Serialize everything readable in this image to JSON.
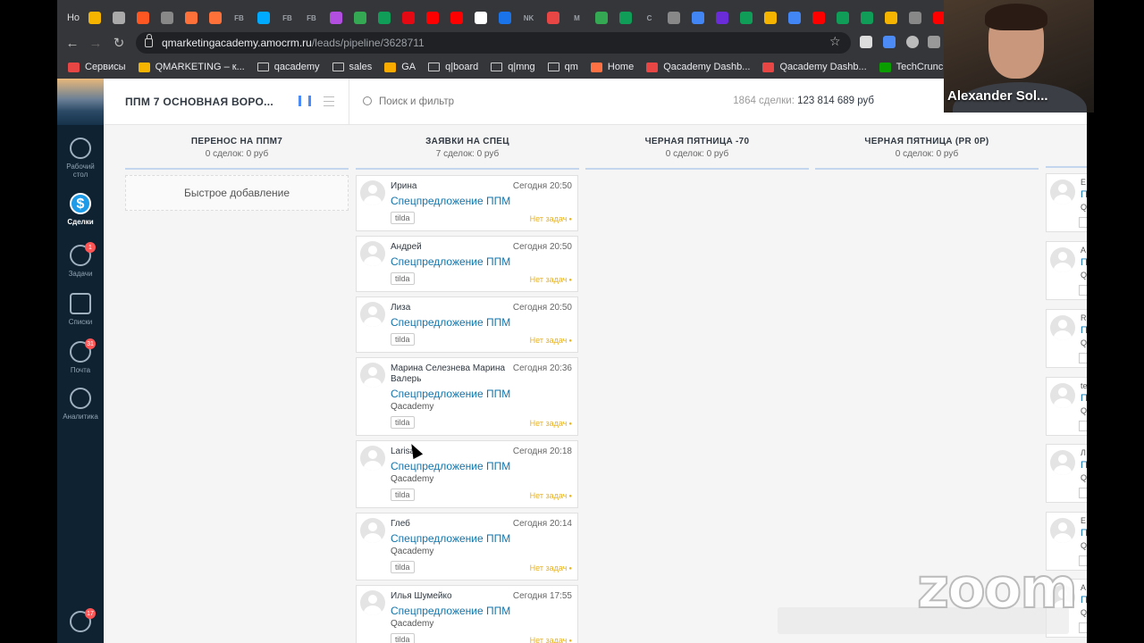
{
  "browser": {
    "first_tab": "Но",
    "tab_favicons": [
      {
        "icon": "google-drive-icon",
        "color": "#f4b400"
      },
      {
        "icon": "scissors-icon",
        "color": "#aaaaaa"
      },
      {
        "icon": "blogger-icon",
        "color": "#ff5722"
      },
      {
        "icon": "m-icon",
        "color": "#888888"
      },
      {
        "icon": "firefox-icon",
        "color": "#ff7139"
      },
      {
        "icon": "firefox-icon",
        "color": "#ff7139"
      },
      {
        "label": "FB",
        "icon": "fb-text-icon",
        "color": "#5f6368"
      },
      {
        "icon": "p-icon",
        "color": "#00aaff"
      },
      {
        "label": "FB",
        "icon": "fb-text-icon",
        "color": "#5f6368"
      },
      {
        "label": "FB",
        "icon": "fb-text-icon",
        "color": "#5f6368"
      },
      {
        "icon": "triangle-icon",
        "color": "#b34fe0"
      },
      {
        "icon": "green-circle-icon",
        "color": "#34a853"
      },
      {
        "icon": "sheets-icon",
        "color": "#0f9d58"
      },
      {
        "icon": "netflix-icon",
        "color": "#e50914"
      },
      {
        "icon": "youtube-icon",
        "color": "#ff0000"
      },
      {
        "icon": "youtube-icon",
        "color": "#ff0000"
      },
      {
        "icon": "reddit-icon",
        "color": "#ffffff"
      },
      {
        "icon": "doc-icon",
        "color": "#1a73e8"
      },
      {
        "label": "NK",
        "icon": "nk-icon",
        "color": "#444444"
      },
      {
        "icon": "k-icon",
        "color": "#e84545"
      },
      {
        "label": "M",
        "icon": "medium-icon",
        "color": "#000000"
      },
      {
        "icon": "gear-green-icon",
        "color": "#34a853"
      },
      {
        "icon": "leaf-icon",
        "color": "#0f9d58"
      },
      {
        "label": "C",
        "icon": "c-icon",
        "color": "#1a73e8"
      },
      {
        "icon": "grey-circle-icon",
        "color": "#888888"
      },
      {
        "icon": "docs-icon",
        "color": "#4285f4"
      },
      {
        "icon": "slack-icon",
        "color": "#6a2bd8"
      },
      {
        "icon": "sheets-plus-icon",
        "color": "#0f9d58"
      },
      {
        "icon": "smile-icon",
        "color": "#f4b400"
      },
      {
        "icon": "docs-icon",
        "color": "#4285f4"
      },
      {
        "icon": "youtube-icon",
        "color": "#ff0000"
      },
      {
        "icon": "sheets-plus-icon",
        "color": "#0f9d58"
      },
      {
        "icon": "sheets-plus-icon",
        "color": "#0f9d58"
      },
      {
        "icon": "slides-icon",
        "color": "#f4b400"
      },
      {
        "icon": "folder-icon",
        "color": "#888888"
      },
      {
        "icon": "youtube-icon",
        "color": "#ff0000"
      }
    ],
    "url_host": "qmarketingacademy.amocrm.ru",
    "url_path": "/leads/pipeline/3628711",
    "bookmarks": [
      {
        "label": "Сервисы",
        "icon": "apps-icon",
        "color": "#e84545"
      },
      {
        "label": "QMARKETING – к...",
        "icon": "qm-icon",
        "color": "#f4b400"
      },
      {
        "label": "qacademy",
        "icon": "folder-icon",
        "color": "#cccccc"
      },
      {
        "label": "sales",
        "icon": "folder-icon",
        "color": "#cccccc"
      },
      {
        "label": "GA",
        "icon": "analytics-icon",
        "color": "#f9ab00"
      },
      {
        "label": "q|board",
        "icon": "folder-icon",
        "color": "#cccccc"
      },
      {
        "label": "q|mng",
        "icon": "folder-icon",
        "color": "#cccccc"
      },
      {
        "label": "qm",
        "icon": "folder-icon",
        "color": "#cccccc"
      },
      {
        "label": "Home",
        "icon": "home-icon",
        "color": "#ff7043"
      },
      {
        "label": "Qacademy Dashb...",
        "icon": "dashboard-icon",
        "color": "#e84545"
      },
      {
        "label": "Qacademy Dashb...",
        "icon": "flag-icon",
        "color": "#e84545"
      },
      {
        "label": "TechCrunch",
        "icon": "techcrunch-icon",
        "color": "#0a9e01"
      }
    ]
  },
  "sidebar": {
    "items": [
      {
        "label": "Рабочий стол",
        "icon": "dashboard-gauge-icon"
      },
      {
        "label": "Сделки",
        "icon": "deals-dollar-icon",
        "active": true
      },
      {
        "label": "Задачи",
        "icon": "tasks-check-icon",
        "badge": "1"
      },
      {
        "label": "Списки",
        "icon": "lists-icon"
      },
      {
        "label": "Почта",
        "icon": "mail-icon",
        "badge": "31"
      },
      {
        "label": "Аналитика",
        "icon": "analytics-chart-icon"
      }
    ],
    "chat_badge": "17"
  },
  "topbar": {
    "pipeline_title": "ППМ 7 ОСНОВНАЯ ВОРО...",
    "search_placeholder": "Поиск и фильтр",
    "deals_count": "1864 сделки:",
    "deals_sum": "123 814 689 руб"
  },
  "columns": [
    {
      "name": "ПЕРЕНОС НА ППМ7",
      "meta": "0 сделок: 0 руб",
      "quick_add": "Быстрое добавление"
    },
    {
      "name": "ЗАЯВКИ НА СПЕЦ",
      "meta": "7 сделок: 0 руб"
    },
    {
      "name": "ЧЕРНАЯ ПЯТНИЦА -70",
      "meta": "0 сделок: 0 руб"
    },
    {
      "name": "ЧЕРНАЯ ПЯТНИЦА (PR 0P)",
      "meta": "0 сделок: 0 руб"
    }
  ],
  "cards": [
    {
      "name": "Ирина",
      "date": "Сегодня 20:50",
      "deal": "Спецпредложение ППМ",
      "company": "",
      "tag": "tilda",
      "task": "Нет задач"
    },
    {
      "name": "Андрей",
      "date": "Сегодня 20:50",
      "deal": "Спецпредложение ППМ",
      "company": "",
      "tag": "tilda",
      "task": "Нет задач"
    },
    {
      "name": "Лиза",
      "date": "Сегодня 20:50",
      "deal": "Спецпредложение ППМ",
      "company": "",
      "tag": "tilda",
      "task": "Нет задач"
    },
    {
      "name": "Марина Селезнева Марина Валерь",
      "date": "Сегодня 20:36",
      "deal": "Спецпредложение ППМ",
      "company": "Qacademy",
      "tag": "tilda",
      "task": "Нет задач"
    },
    {
      "name": "Larisa",
      "date": "Сегодня 20:18",
      "deal": "Спецпредложение ППМ",
      "company": "Qacademy",
      "tag": "tilda",
      "task": "Нет задач"
    },
    {
      "name": "Глеб",
      "date": "Сегодня 20:14",
      "deal": "Спецпредложение ППМ",
      "company": "Qacademy",
      "tag": "tilda",
      "task": "Нет задач"
    },
    {
      "name": "Илья Шумейко",
      "date": "Сегодня 17:55",
      "deal": "Спецпредложение ППМ",
      "company": "Qacademy",
      "tag": "tilda",
      "task": "Нет задач"
    }
  ],
  "peek_cards": [
    {
      "l": "Е",
      "d": "П",
      "c": "Q"
    },
    {
      "l": "А",
      "d": "П",
      "c": "Q"
    },
    {
      "l": "R",
      "d": "П",
      "c": "Q"
    },
    {
      "l": "te",
      "d": "П",
      "c": "Q"
    },
    {
      "l": "Л",
      "d": "П",
      "c": "Q"
    },
    {
      "l": "Е",
      "d": "П",
      "c": "Q"
    },
    {
      "l": "А",
      "d": "П",
      "c": "Q"
    }
  ],
  "webcam": {
    "name": "Alexander Sol..."
  },
  "watermark": "zoom"
}
